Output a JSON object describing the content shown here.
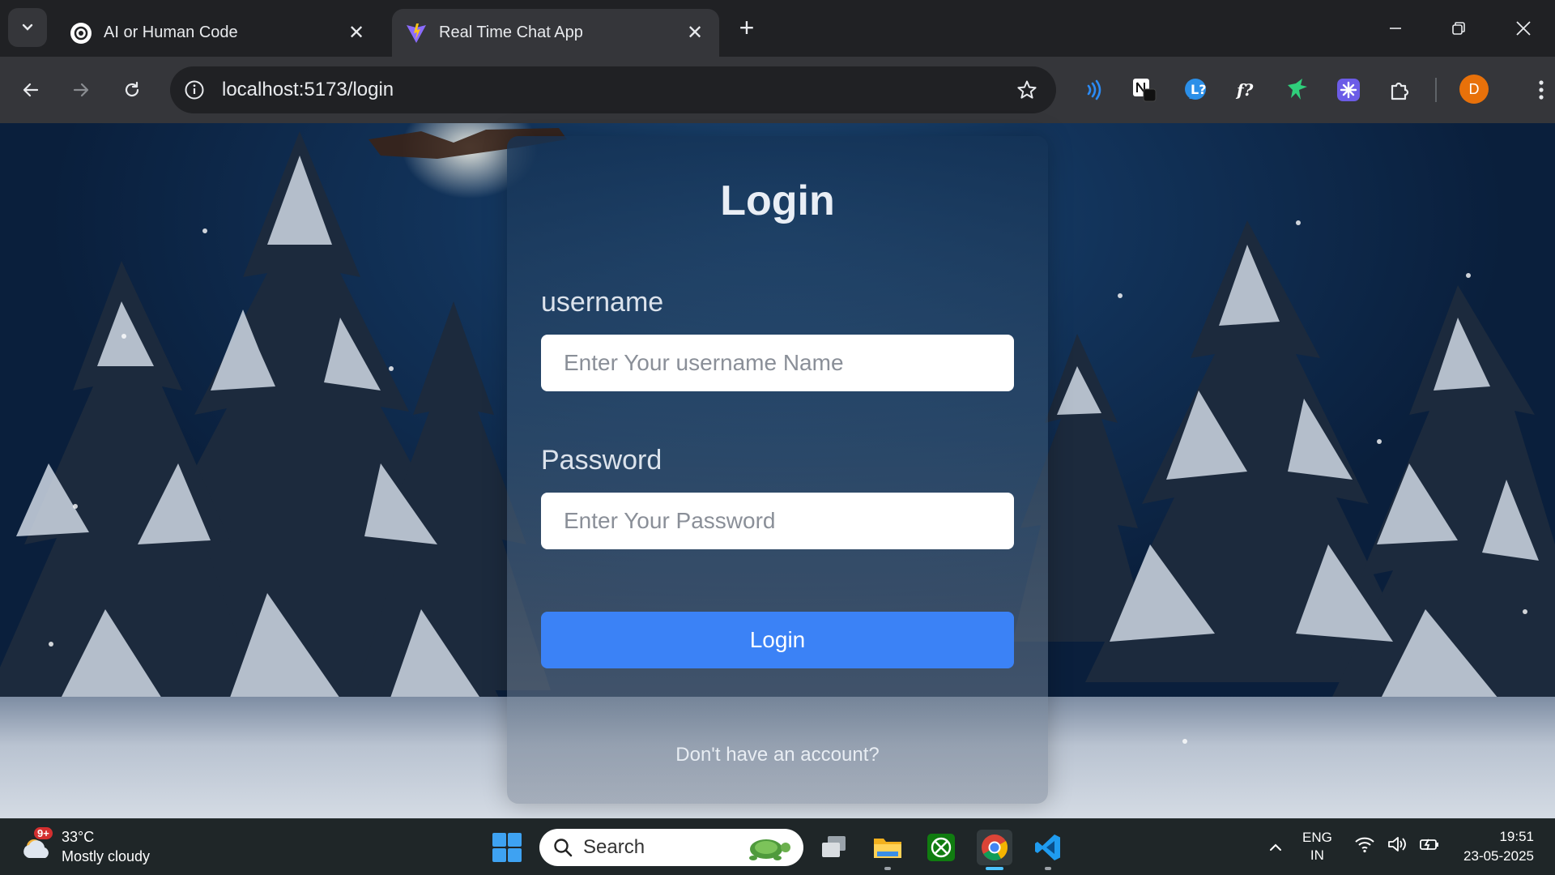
{
  "browser": {
    "tabs": [
      {
        "title": "AI or Human Code",
        "favicon": "openai-icon",
        "active": false
      },
      {
        "title": "Real Time Chat App",
        "favicon": "vite-icon",
        "active": true
      }
    ],
    "url": "localhost:5173/login",
    "profile_initial": "D",
    "extensions": [
      "read-aloud-icon",
      "notion-web-clipper-icon",
      "language-tool-icon",
      "font-finder-icon",
      "monkey-extension-icon",
      "sparkle-extension-icon",
      "puzzle-extensions-icon"
    ]
  },
  "login_card": {
    "title": "Login",
    "username_label": "username",
    "username_placeholder": "Enter Your username Name",
    "password_label": "Password",
    "password_placeholder": "Enter Your Password",
    "submit_label": "Login",
    "signup_prompt": "Don't have an account?"
  },
  "taskbar": {
    "weather_badge": "9+",
    "temperature": "33°C",
    "weather_text": "Mostly cloudy",
    "search_label": "Search",
    "language_line1": "ENG",
    "language_line2": "IN",
    "time": "19:51",
    "date": "23-05-2025"
  },
  "colors": {
    "accent_button": "#3b82f6",
    "browser_dark": "#202124",
    "toolbar": "#35363a",
    "profile": "#e8710a"
  }
}
